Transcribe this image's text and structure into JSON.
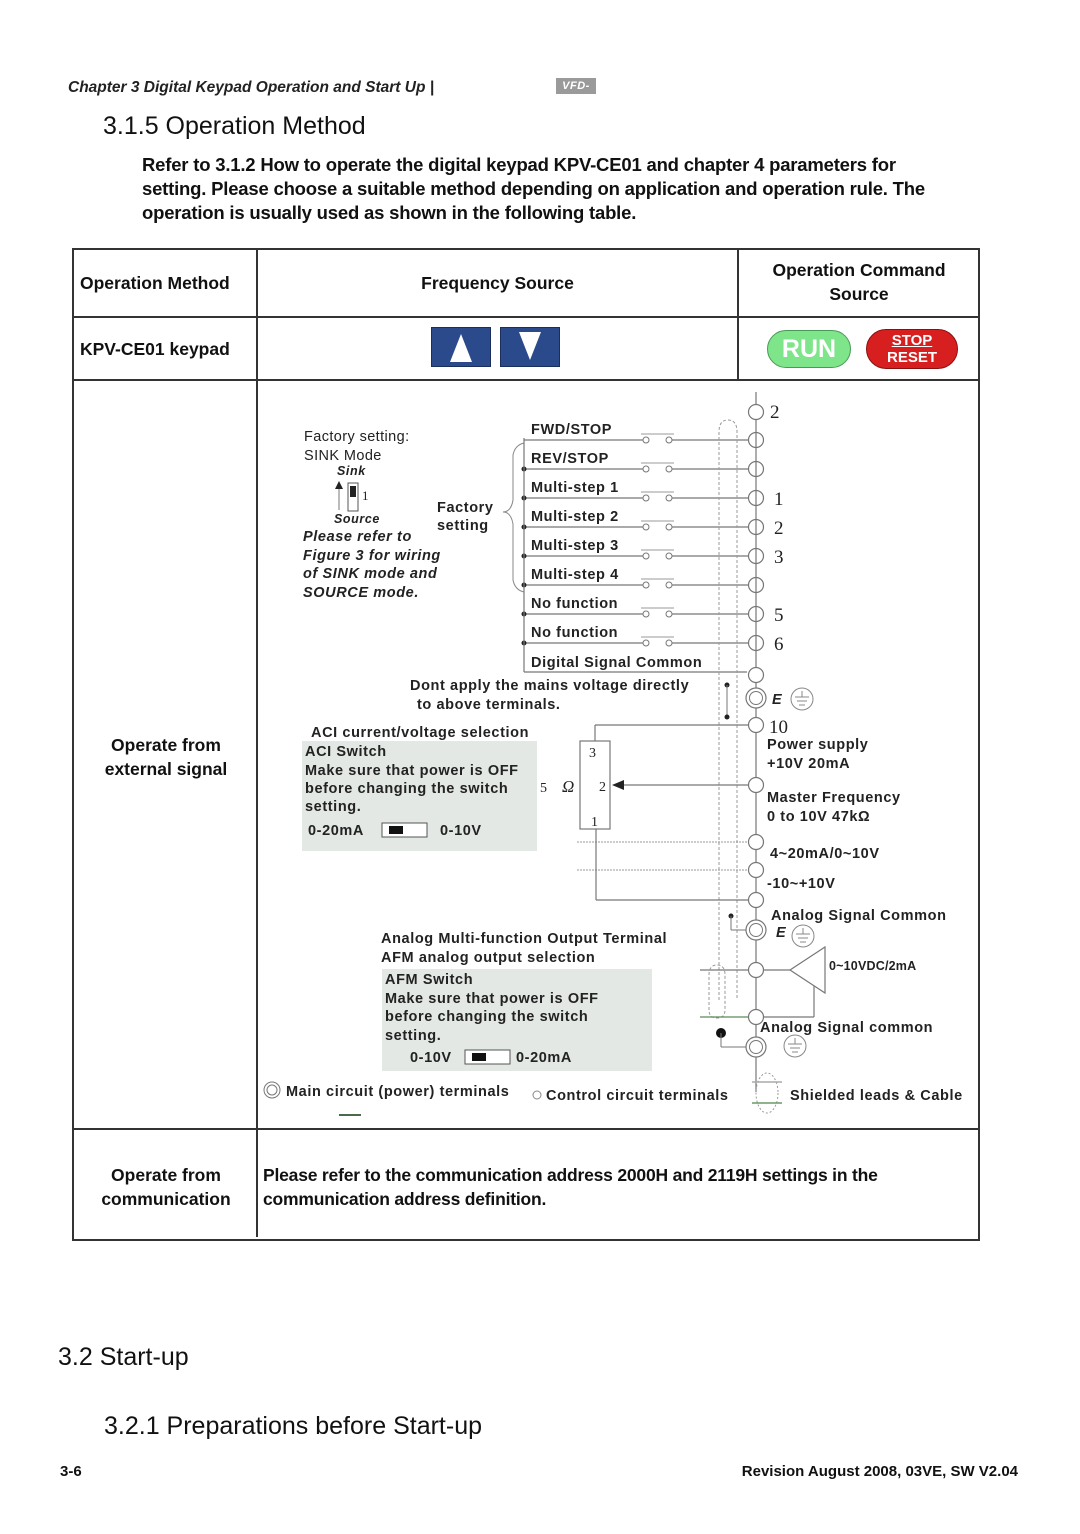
{
  "header": {
    "running_title": "Chapter 3 Digital Keypad Operation and Start Up |",
    "logo_text": "VFD-VE"
  },
  "section": {
    "title": "3.1.5 Operation Method",
    "intro_lines": [
      "Refer to 3.1.2 How to operate the digital keypad KPV-CE01 and chapter 4 parameters for",
      "setting. Please choose a suitable method depending on application and operation rule. The",
      "operation is usually used as shown in the following table."
    ]
  },
  "table": {
    "headers": {
      "method": "Operation Method",
      "frequency": "Frequency Source",
      "command_line1": "Operation Command",
      "command_line2": "Source"
    },
    "rows": {
      "keypad": {
        "method": "KPV-CE01 keypad",
        "frequency_keys": [
          "up-arrow-key",
          "down-arrow-key"
        ],
        "run_label": "RUN",
        "stop_label": "STOP",
        "reset_label": "RESET"
      },
      "external": {
        "method_line1": "Operate from",
        "method_line2": "external signal"
      },
      "communication": {
        "method_line1": "Operate from",
        "method_line2": "communication",
        "text_line1": "Please refer to the communication address 2000H and 2119H settings in the",
        "text_line2": "communication address definition."
      }
    }
  },
  "wiring_diagram": {
    "factory_setting_line1": "Factory setting:",
    "factory_setting_line2": "SINK Mode",
    "sink_label": "Sink",
    "source_label": "Source",
    "switch_number": "1",
    "refer_lines": [
      "Please refer to",
      "Figure 3 for wiring",
      "of SINK mode and",
      "SOURCE mode."
    ],
    "factory_brace_line1": "Factory",
    "factory_brace_line2": "setting",
    "digital_inputs": [
      {
        "label": "FWD/STOP",
        "terminal_number": ""
      },
      {
        "label": "REV/STOP",
        "terminal_number": ""
      },
      {
        "label": "Multi-step 1",
        "terminal_number": "1"
      },
      {
        "label": "Multi-step 2",
        "terminal_number": "2"
      },
      {
        "label": "Multi-step 3",
        "terminal_number": "3"
      },
      {
        "label": "Multi-step 4",
        "terminal_number": ""
      },
      {
        "label": "No function",
        "terminal_number": "5"
      },
      {
        "label": "No function",
        "terminal_number": "6"
      }
    ],
    "top_terminal_number": "2",
    "digital_common": "Digital Signal Common",
    "warning_line1": "Dont apply the mains voltage directly",
    "warning_line2": "to above terminals.",
    "earth_label": "E",
    "terminal_10": "10",
    "aci_selection": "ACI current/voltage selection",
    "aci_switch": {
      "title": "ACI Switch",
      "line1": "Make sure that power is OFF",
      "line2": "before changing the switch",
      "line3": "setting.",
      "left_option": "0-20mA",
      "right_option": "0-10V"
    },
    "pot": {
      "pin3": "3",
      "pin2": "2",
      "pin1": "1",
      "value": "5",
      "unit": "Ω"
    },
    "power_supply_line1": "Power supply",
    "power_supply_line2": "+10V 20mA",
    "master_freq_line1": "Master Frequency",
    "master_freq_line2": "0 to 10V 47kΩ",
    "aci_range": "4~20mA/0~10V",
    "aui_range": "-10~+10V",
    "analog_common": "Analog Signal Common",
    "afm_title": "Analog Multi-function Output Terminal",
    "afm_selection": "AFM analog output selection",
    "afm_switch": {
      "title": "AFM Switch",
      "line1": "Make sure that power is OFF",
      "line2": "before changing the switch",
      "line3": "setting.",
      "left_option": "0-10V",
      "right_option": "0-20mA"
    },
    "afm_output": "0~10VDC/2mA",
    "analog_common_lower": "Analog Signal common",
    "legend": {
      "main_circuit": "Main circuit (power) terminals",
      "control_circuit": "Control circuit terminals",
      "shielded": "Shielded leads & Cable"
    }
  },
  "startup": {
    "title": "3.2 Start-up",
    "subtitle": "3.2.1 Preparations before Start-up"
  },
  "footer": {
    "page_number": "3-6",
    "revision": "Revision August 2008, 03VE, SW V2.04"
  },
  "colors": {
    "arrow_key_blue": "#2b4a8c",
    "run_green": "#7fe58a",
    "stop_red": "#d81f1f",
    "switch_panel_gray": "#e3e8e4"
  }
}
